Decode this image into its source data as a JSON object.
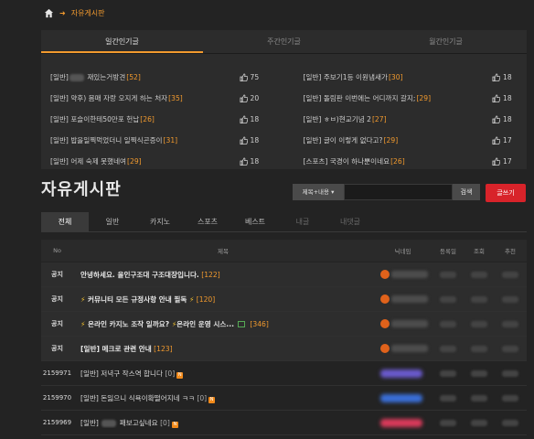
{
  "breadcrumb": {
    "sep": "➜",
    "current": "자유게시판"
  },
  "popular": {
    "tabs": [
      "일간인기글",
      "주간인기글",
      "월간인기글"
    ],
    "items": [
      {
        "title_pre": "[일반]",
        "title": " 재있는거방견",
        "comments": "[52]",
        "likes": "75",
        "blur": true
      },
      {
        "title_pre": "[일반]",
        "title": " 주보기1등 이원냄새가",
        "comments": "[30]",
        "likes": "18",
        "blur": false
      },
      {
        "title_pre": "[일반]",
        "title": " 약후) 몸매 자랑 오지게 하는 처자",
        "comments": "[35]",
        "likes": "20",
        "blur": false
      },
      {
        "title_pre": "[일반]",
        "title": " 돌림판 이번에는 어디까지 갈지;",
        "comments": "[29]",
        "likes": "18",
        "blur": false
      },
      {
        "title_pre": "[일반]",
        "title": " 포슬이한테50만포 헌납",
        "comments": "[26]",
        "likes": "18",
        "blur": false
      },
      {
        "title_pre": "[일반]",
        "title": " ㅎㅂ)현교기념 2",
        "comments": "[27]",
        "likes": "18",
        "blur": false
      },
      {
        "title_pre": "[일반]",
        "title": " 밥을일찍먹었더니 일찍식곤증이",
        "comments": "[31]",
        "likes": "18",
        "blur": false
      },
      {
        "title_pre": "[일반]",
        "title": " 글이 이렇게 없다고?",
        "comments": "[29]",
        "likes": "17",
        "blur": false
      },
      {
        "title_pre": "[일반]",
        "title": " 어제 숙제 못했네여",
        "comments": "[29]",
        "likes": "18",
        "blur": false
      },
      {
        "title_pre": "[스포츠]",
        "title": " 국경이 하나뿐이네요",
        "comments": "[26]",
        "likes": "17",
        "blur": false
      }
    ]
  },
  "board": {
    "title": "자유게시판",
    "search_select": "제목+내용 ▾",
    "search_button": "검색",
    "write_button": "글쓰기",
    "tabs": [
      "전체",
      "일반",
      "카지노",
      "스포츠",
      "베스트",
      "내글",
      "내댓글"
    ],
    "columns": {
      "no": "No",
      "title": "제목",
      "nick": "닉네임",
      "date": "등록일",
      "view": "조회",
      "rec": "추천"
    },
    "notices": [
      {
        "no": "공지",
        "title": "안녕하세요. 올인구조대 구조대장입니다.",
        "comments": "[122]"
      },
      {
        "no": "공지",
        "title": "커뮤니티 모든 규정사항 안내 필독",
        "comments": "[120]"
      },
      {
        "no": "공지",
        "title": "온라인 카지노 조작 일까요? ",
        "title2": "온라인 운영 시스...",
        "comments": "[346]"
      },
      {
        "no": "공지",
        "title": "[일반] 메크로 관련 안내",
        "comments": "[123]"
      }
    ],
    "posts": [
      {
        "no": "2159971",
        "title": "[일반] 저녁구 작스역 합니다",
        "comments": "[0]",
        "nick_color": "#6a5acd"
      },
      {
        "no": "2159970",
        "title": "[일반] 돈잃으니 식욕이확떨어지네 ㅋㅋ",
        "comments": "[0]",
        "nick_color": "#3a6fd8"
      },
      {
        "no": "2159969",
        "title": "[일반]",
        "title2": "패보고싶네요",
        "comments": "[0]",
        "nick_color": "#d83a5a"
      }
    ]
  }
}
